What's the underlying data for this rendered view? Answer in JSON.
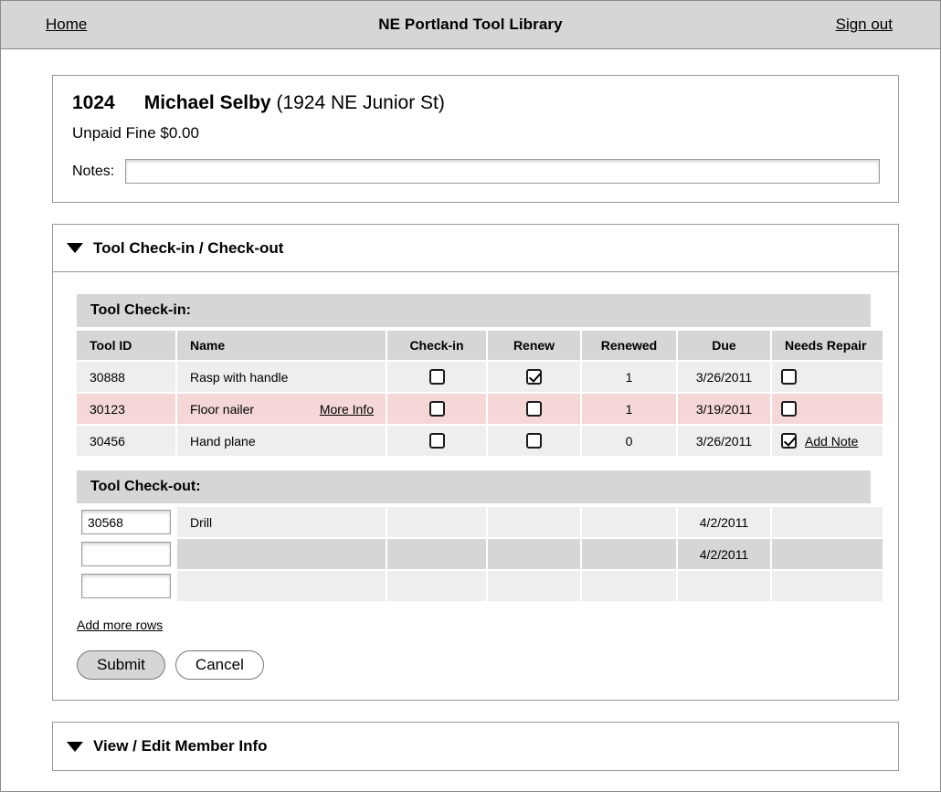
{
  "topbar": {
    "home_label": "Home",
    "app_title": "NE Portland Tool Library",
    "signout_label": "Sign out"
  },
  "member": {
    "id": "1024",
    "name": "Michael Selby",
    "address": "(1924 NE Junior St)",
    "unpaid_fine_label": "Unpaid Fine $0.00",
    "notes_label": "Notes:",
    "notes_value": "",
    "notes_placeholder": ""
  },
  "checkin_section": {
    "title": "Tool Check-in / Check-out",
    "checkin_heading": "Tool Check-in:",
    "checkout_heading": "Tool Check-out:",
    "columns": [
      "Tool ID",
      "Name",
      "Check-in",
      "Renew",
      "Renewed",
      "Due",
      "Needs Repair"
    ],
    "checkin_rows": [
      {
        "tool_id": "30888",
        "name": "Rasp with handle",
        "more_info": "",
        "checkin": false,
        "renew": true,
        "renewed": "1",
        "due": "3/26/2011",
        "needs_repair": false,
        "add_note": "",
        "overdue": false
      },
      {
        "tool_id": "30123",
        "name": "Floor nailer",
        "more_info": "More Info",
        "checkin": false,
        "renew": false,
        "renewed": "1",
        "due": "3/19/2011",
        "needs_repair": false,
        "add_note": "",
        "overdue": true
      },
      {
        "tool_id": "30456",
        "name": "Hand plane",
        "more_info": "",
        "checkin": false,
        "renew": false,
        "renewed": "0",
        "due": "3/26/2011",
        "needs_repair": true,
        "add_note": "Add Note",
        "overdue": false
      }
    ],
    "checkout_rows": [
      {
        "tool_id": "30568",
        "name": "Drill",
        "due": "4/2/2011",
        "alt": false
      },
      {
        "tool_id": "",
        "name": "",
        "due": "4/2/2011",
        "alt": true
      },
      {
        "tool_id": "",
        "name": "",
        "due": "",
        "alt": false
      }
    ],
    "add_more_rows_label": "Add more rows",
    "submit_label": "Submit",
    "cancel_label": "Cancel"
  },
  "member_info_section": {
    "title": "View / Edit Member Info"
  },
  "colors": {
    "topbar_bg": "#d6d6d6",
    "header_cell_bg": "#d6d6d6",
    "row_bg": "#eeeeee",
    "overdue_bg": "#f5d7d7",
    "alt_row_bg": "#d6d6d6",
    "border": "#9a9a9a"
  }
}
